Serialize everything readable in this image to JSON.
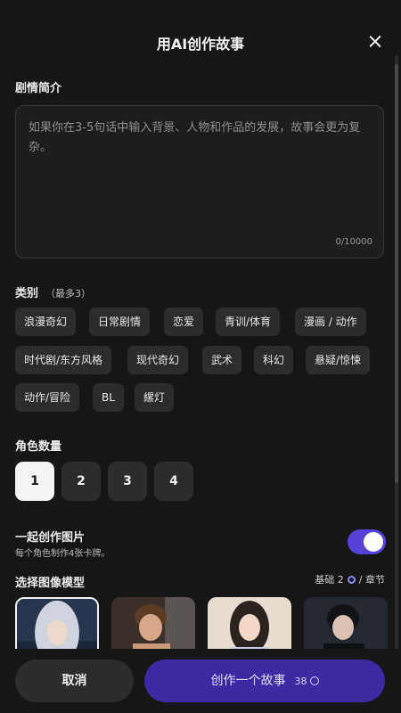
{
  "header": {
    "title": "用AI创作故事"
  },
  "plot": {
    "label": "剧情简介",
    "placeholder": "如果你在3-5句话中输入背景、人物和作品的发展，故事会更为复杂。",
    "counter": "0/10000"
  },
  "genre": {
    "label": "类别",
    "hint": "（最多3）",
    "chips": [
      "浪漫奇幻",
      "日常剧情",
      "恋爱",
      "青训/体育",
      "漫画 / 动作",
      "时代剧/东方风格",
      "现代奇幻",
      "武术",
      "科幻",
      "悬疑/惊悚",
      "动作/冒险",
      "BL",
      "縲灯"
    ]
  },
  "characters": {
    "label": "角色数量",
    "options": [
      "1",
      "2",
      "3",
      "4"
    ],
    "selected": "1"
  },
  "images": {
    "label": "一起创作图片",
    "sub": "每个角色制作4张卡牌。",
    "enabled": true,
    "accent": "#5543d8"
  },
  "model": {
    "label": "选择图像模型",
    "meta_prefix": "基础 2",
    "meta_suffix": "/ 章节"
  },
  "actions": {
    "cancel": "取消",
    "create": "创作一个故事",
    "cost": "38"
  }
}
